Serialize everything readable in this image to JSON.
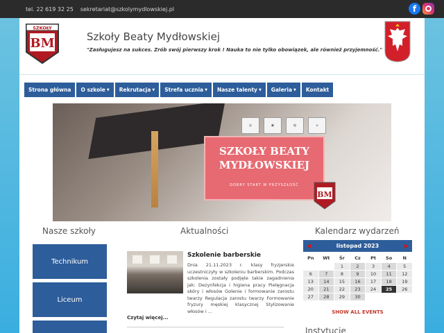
{
  "topbar": {
    "phone": "tel. 22 619 32 25",
    "email": "sekretariat@szkolymydlowskiej.pl",
    "facebook_icon": "facebook-icon",
    "instagram_icon": "instagram-icon"
  },
  "header": {
    "logo_top": "SZKOŁY",
    "logo_letters": "BM",
    "title": "Szkoły Beaty Mydłowskiej",
    "slogan": "\"Zasługujesz na sukces. Zrób swój pierwszy krok ! Nauka to nie tylko obowiązek, ale również przyjemność.\""
  },
  "nav": [
    {
      "label": "Strona główna",
      "caret": false
    },
    {
      "label": "O szkole",
      "caret": true
    },
    {
      "label": "Rekrutacja",
      "caret": true
    },
    {
      "label": "Strefa ucznia",
      "caret": true
    },
    {
      "label": "Nasze talenty",
      "caret": true
    },
    {
      "label": "Galeria",
      "caret": true
    },
    {
      "label": "Kontakt",
      "caret": false
    }
  ],
  "banner": {
    "title_line1": "SZKOŁY BEATY",
    "title_line2": "MYDŁOWSKIEJ",
    "subtitle": "DOBRY START W PRZYSZŁOŚĆ",
    "mini_logo": "BM"
  },
  "columns": {
    "schools_title": "Nasze szkoły",
    "news_title": "Aktualności",
    "calendar_title": "Kalendarz wydarzeń",
    "institutions_title": "Instytucje"
  },
  "schools": [
    "Technikum",
    "Liceum"
  ],
  "news": {
    "title": "Szkolenie barberskie",
    "text": "Dnia 21.11.2023 r. klasy fryzjerskie uczestniczyły w szkoleniu barberskim. Podczas szkolenia zostały podjęte takie zagadnienia jak: Dezynfekcja i higiena pracy Pielęgnacja skóry i włosów Golenie i formowanie zarostu twarzy Regulacja zarostu twarzy Formowanie fryzury męskiej klasycznej Stylizowanie włosów i ...",
    "more": "Czytaj więcej..."
  },
  "calendar": {
    "month": "listopad 2023",
    "prev": "◀",
    "next": "▶",
    "weekdays": [
      "Pn",
      "Wt",
      "Śr",
      "Cz",
      "Pt",
      "So",
      "N"
    ],
    "weeks": [
      [
        "",
        "",
        "1",
        "2",
        "3",
        "4",
        "5"
      ],
      [
        "6",
        "7",
        "8",
        "9",
        "10",
        "11",
        "12"
      ],
      [
        "13",
        "14",
        "15",
        "16",
        "17",
        "18",
        "19"
      ],
      [
        "20",
        "21",
        "22",
        "23",
        "24",
        "25",
        "26"
      ],
      [
        "27",
        "28",
        "29",
        "30",
        "",
        "",
        ""
      ]
    ],
    "today": "25",
    "show_all": "SHOW ALL EVENTS"
  }
}
